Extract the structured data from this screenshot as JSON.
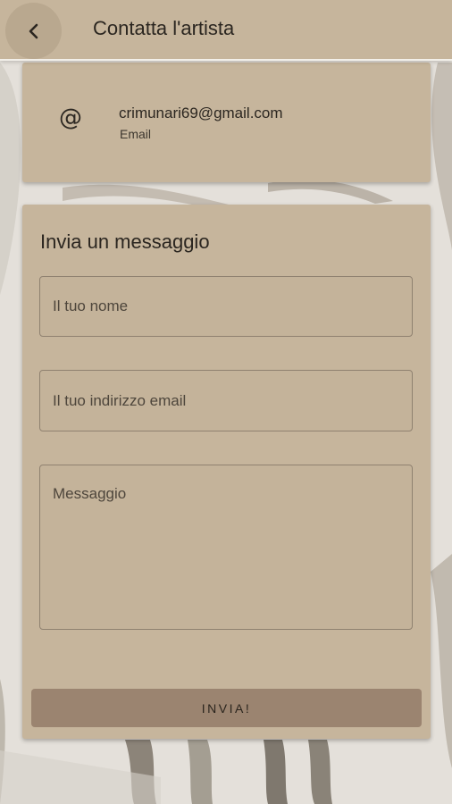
{
  "appbar": {
    "title": "Contatta l'artista",
    "back_icon": "chevron-left-icon"
  },
  "contact": {
    "icon": "at-sign-icon",
    "icon_glyph": "@",
    "value": "crimunari69@gmail.com",
    "label": "Email"
  },
  "form": {
    "title": "Invia un messaggio",
    "name_placeholder": "Il tuo nome",
    "email_placeholder": "Il tuo indirizzo email",
    "message_placeholder": "Messaggio",
    "send_label": "INVIA!"
  },
  "colors": {
    "appbar": "#c6b59c",
    "card": "#c6b59c",
    "button": "#9b8470",
    "background": "#e6e2dc"
  }
}
